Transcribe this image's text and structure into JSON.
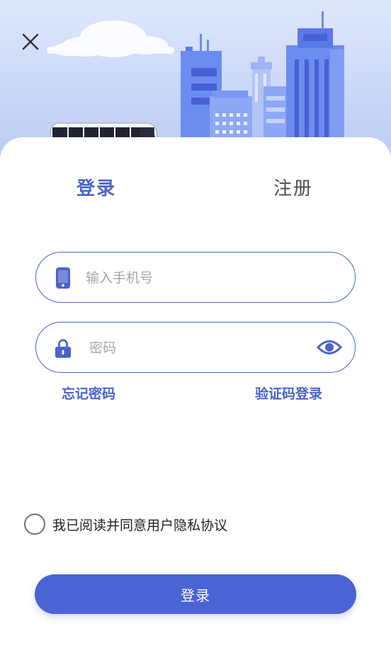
{
  "header": {
    "close_icon": "close-icon",
    "illustration": "city-buildings-and-bus"
  },
  "tabs": [
    {
      "label": "登录",
      "active": true
    },
    {
      "label": "注册",
      "active": false
    }
  ],
  "form": {
    "phone": {
      "placeholder": "输入手机号",
      "value": "",
      "icon": "phone-icon"
    },
    "password": {
      "placeholder": "密码",
      "value": "",
      "icon": "lock-icon",
      "toggle_icon": "eye-icon"
    }
  },
  "links": {
    "forgot_password": "忘记密码",
    "sms_login": "验证码登录"
  },
  "agreement": {
    "text": "我已阅读并同意用户隐私协议",
    "checked": false
  },
  "submit_label": "登录",
  "colors": {
    "primary": "#4a64d3",
    "accent_text": "#4a64c9",
    "hero_bg": "#c9d6f7"
  }
}
